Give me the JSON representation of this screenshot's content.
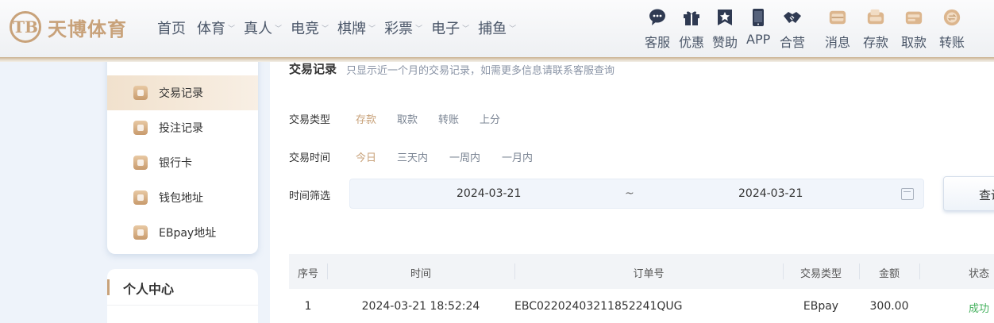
{
  "header": {
    "logo_mark": "TB",
    "logo_text": "天博体育",
    "nav": [
      {
        "label": "首页",
        "dropdown": false
      },
      {
        "label": "体育",
        "dropdown": true
      },
      {
        "label": "真人",
        "dropdown": true
      },
      {
        "label": "电竞",
        "dropdown": true
      },
      {
        "label": "棋牌",
        "dropdown": true
      },
      {
        "label": "彩票",
        "dropdown": true
      },
      {
        "label": "电子",
        "dropdown": true
      },
      {
        "label": "捕鱼",
        "dropdown": true
      }
    ],
    "tools": [
      {
        "label": "客服",
        "icon": "chat-icon"
      },
      {
        "label": "优惠",
        "icon": "gift-icon"
      },
      {
        "label": "赞助",
        "icon": "star-badge-icon"
      },
      {
        "label": "APP",
        "icon": "phone-icon"
      },
      {
        "label": "合营",
        "icon": "handshake-icon"
      },
      {
        "label": "消息",
        "icon": "message-icon"
      },
      {
        "label": "存款",
        "icon": "deposit-icon"
      },
      {
        "label": "取款",
        "icon": "withdraw-icon"
      },
      {
        "label": "转账",
        "icon": "transfer-icon"
      }
    ]
  },
  "sidebar": {
    "items": [
      {
        "label": "交易记录",
        "active": true,
        "icon": "transaction-icon"
      },
      {
        "label": "投注记录",
        "active": false,
        "icon": "bet-record-icon"
      },
      {
        "label": "银行卡",
        "active": false,
        "icon": "bank-card-icon"
      },
      {
        "label": "钱包地址",
        "active": false,
        "icon": "wallet-icon"
      },
      {
        "label": "EBpay地址",
        "active": false,
        "icon": "ebpay-icon"
      }
    ],
    "section2_title": "个人中心"
  },
  "main": {
    "title": "交易记录",
    "tip": "只显示近一个月的交易记录，如需更多信息请联系客服查询",
    "type_label": "交易类型",
    "type_options": [
      "存款",
      "取款",
      "转账",
      "上分"
    ],
    "time_label": "交易时间",
    "time_options": [
      "今日",
      "三天内",
      "一周内",
      "一月内"
    ],
    "range_label": "时间筛选",
    "date_from": "2024-03-21",
    "date_sep": "~",
    "date_to": "2024-03-21",
    "search_button": "查询"
  },
  "table": {
    "headers": [
      "序号",
      "时间",
      "订单号",
      "交易类型",
      "金额",
      "状态"
    ],
    "rows": [
      [
        "1",
        "2024-03-21 18:52:24",
        "EBC02202403211852241QUG",
        "EBpay",
        "300.00",
        "成功"
      ]
    ]
  },
  "colors": {
    "accent": "#c8a27a",
    "success": "#43b05c",
    "text_muted": "#7a8493"
  }
}
